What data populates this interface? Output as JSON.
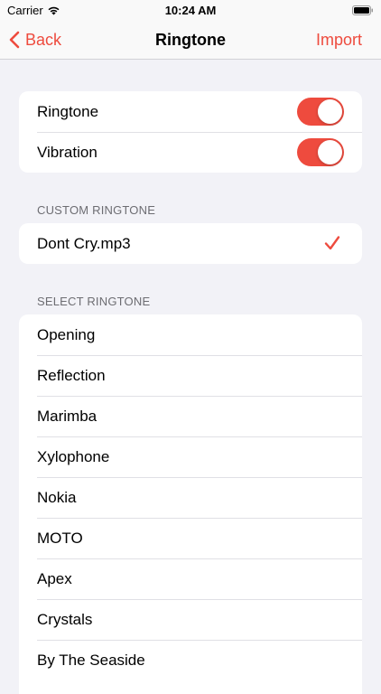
{
  "status_bar": {
    "carrier": "Carrier",
    "time": "10:24 AM"
  },
  "nav": {
    "back_label": "Back",
    "title": "Ringtone",
    "import_label": "Import"
  },
  "toggles": [
    {
      "label": "Ringtone",
      "on": true
    },
    {
      "label": "Vibration",
      "on": true
    }
  ],
  "custom_section": {
    "header": "CUSTOM RINGTONE",
    "items": [
      {
        "label": "Dont Cry.mp3",
        "selected": true
      }
    ]
  },
  "select_section": {
    "header": "SELECT RINGTONE",
    "items": [
      {
        "label": "Opening"
      },
      {
        "label": "Reflection"
      },
      {
        "label": "Marimba"
      },
      {
        "label": "Xylophone"
      },
      {
        "label": "Nokia"
      },
      {
        "label": "MOTO"
      },
      {
        "label": "Apex"
      },
      {
        "label": "Crystals"
      },
      {
        "label": "By The Seaside"
      }
    ]
  },
  "colors": {
    "accent": "#ee4b3e",
    "background": "#f2f2f7"
  }
}
